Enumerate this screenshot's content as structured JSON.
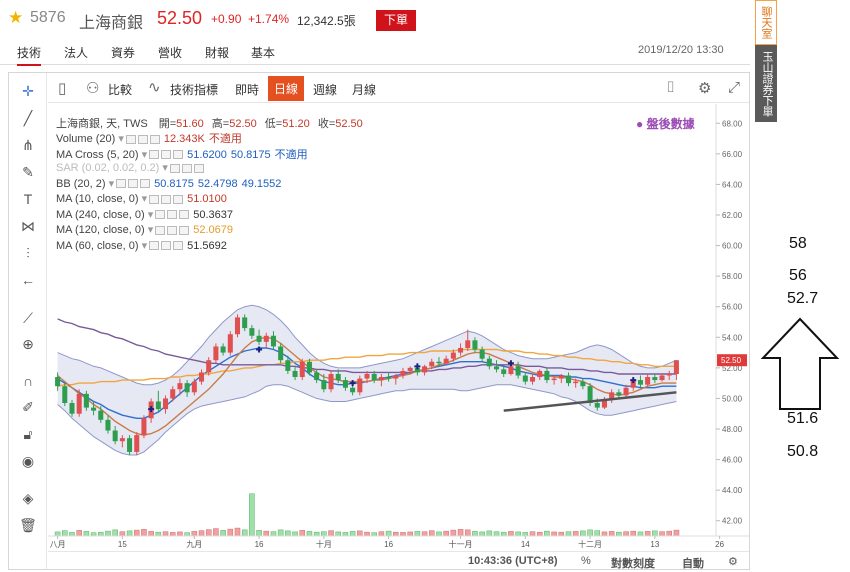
{
  "header": {
    "code": "5876",
    "name": "上海商銀",
    "price": "52.50",
    "change": "+0.90",
    "change_pct": "+1.74%",
    "volume": "12,342.5張",
    "order_button": "下單",
    "star_icon": "star-icon",
    "accent_up": "#e02424",
    "button_color": "#d0121b"
  },
  "tabs": [
    "技術",
    "法人",
    "資券",
    "營收",
    "財報",
    "基本"
  ],
  "datetime": "2019/12/20 13:30",
  "side": {
    "chat": "聊天室",
    "broker": "玉山證券下單"
  },
  "toolbar": {
    "compare": "比較",
    "indicators": "技術指標",
    "intervals": [
      "即時",
      "日線",
      "週線",
      "月線"
    ],
    "active_interval": "日線"
  },
  "legend": {
    "main": {
      "label": "上海商銀, 天, TWS",
      "open_label": "開=",
      "open": "51.60",
      "high_label": "高=",
      "high": "52.50",
      "low_label": "低=",
      "low": "51.20",
      "close_label": "收=",
      "close": "52.50"
    },
    "rows": [
      {
        "label": "Volume (20)",
        "values": [
          "12.343K",
          "不適用"
        ],
        "color": "#c0392b"
      },
      {
        "label": "MA Cross (5, 20)",
        "values": [
          "51.6200",
          "50.8175",
          "不適用"
        ],
        "color": "#1f5fbf"
      },
      {
        "label": "SAR (0.02, 0.02, 0.2)",
        "values": [],
        "color": "#bbbbbb"
      },
      {
        "label": "BB (20, 2)",
        "values": [
          "50.8175",
          "52.4798",
          "49.1552"
        ],
        "color": "#1f5fbf"
      },
      {
        "label": "MA (10, close, 0)",
        "values": [
          "51.0100"
        ],
        "color": "#c0392b"
      },
      {
        "label": "MA (240, close, 0)",
        "values": [
          "50.3637"
        ],
        "color": "#333333"
      },
      {
        "label": "MA (120, close, 0)",
        "values": [
          "52.0679"
        ],
        "color": "#e69b2d"
      },
      {
        "label": "MA (60, close, 0)",
        "values": [
          "51.5692"
        ],
        "color": "#333333"
      }
    ],
    "after_hours": "盤後數據"
  },
  "bottom": {
    "clock": "10:43:36 (UTC+8)",
    "percent": "%",
    "log_scale": "對數刻度",
    "auto": "自動"
  },
  "annotations": {
    "upper": [
      "58",
      "56",
      "52.7"
    ],
    "lower": [
      "51.6",
      "50.8"
    ]
  },
  "chart_data": {
    "type": "candlestick",
    "y_ticks": [
      "68.00",
      "66.00",
      "64.00",
      "62.00",
      "60.00",
      "58.00",
      "56.00",
      "54.00",
      "52.00",
      "50.00",
      "48.00",
      "46.00",
      "44.00",
      "42.00"
    ],
    "ylim": [
      41,
      69
    ],
    "x_ticks": [
      "八月",
      "15",
      "九月",
      "16",
      "十月",
      "16",
      "十一月",
      "14",
      "十二月",
      "13",
      "26"
    ],
    "x_tick_index": [
      0,
      9,
      19,
      28,
      37,
      46,
      56,
      65,
      74,
      83,
      92
    ],
    "last_price": "52.50",
    "colors": {
      "up": "#e05050",
      "down": "#2e9e4e",
      "band": "#dde2f0",
      "band_line": "#8f97c8"
    },
    "ohlc": [
      [
        51.4,
        51.7,
        50.5,
        50.8
      ],
      [
        50.8,
        51.0,
        49.5,
        49.7
      ],
      [
        49.7,
        49.9,
        48.8,
        49.0
      ],
      [
        49.0,
        50.6,
        48.8,
        50.3
      ],
      [
        50.3,
        50.5,
        49.2,
        49.4
      ],
      [
        49.4,
        49.8,
        48.9,
        49.2
      ],
      [
        49.2,
        49.5,
        48.4,
        48.6
      ],
      [
        48.6,
        48.9,
        47.7,
        47.9
      ],
      [
        47.9,
        48.2,
        47.0,
        47.2
      ],
      [
        47.2,
        47.6,
        46.8,
        47.4
      ],
      [
        47.4,
        47.6,
        46.3,
        46.5
      ],
      [
        46.5,
        47.8,
        46.3,
        47.6
      ],
      [
        47.6,
        48.9,
        47.4,
        48.7
      ],
      [
        48.7,
        50.0,
        48.4,
        49.8
      ],
      [
        49.8,
        50.5,
        49.1,
        49.3
      ],
      [
        49.3,
        50.2,
        49.0,
        50.0
      ],
      [
        50.0,
        50.8,
        49.8,
        50.6
      ],
      [
        50.6,
        51.3,
        50.2,
        51.0
      ],
      [
        51.0,
        51.2,
        50.1,
        50.4
      ],
      [
        50.4,
        51.3,
        50.2,
        51.1
      ],
      [
        51.1,
        51.9,
        50.9,
        51.7
      ],
      [
        51.7,
        52.7,
        51.5,
        52.5
      ],
      [
        52.5,
        53.6,
        52.3,
        53.4
      ],
      [
        53.4,
        53.6,
        52.8,
        53.0
      ],
      [
        53.0,
        54.4,
        52.8,
        54.2
      ],
      [
        54.2,
        55.5,
        54.0,
        55.3
      ],
      [
        55.3,
        55.5,
        54.4,
        54.6
      ],
      [
        54.6,
        54.8,
        53.9,
        54.1
      ],
      [
        54.1,
        54.5,
        53.5,
        53.7
      ],
      [
        53.7,
        54.3,
        53.3,
        54.1
      ],
      [
        54.1,
        54.4,
        53.2,
        53.4
      ],
      [
        53.4,
        53.6,
        52.3,
        52.5
      ],
      [
        52.5,
        52.8,
        51.6,
        51.8
      ],
      [
        51.8,
        52.1,
        51.2,
        51.4
      ],
      [
        51.4,
        52.6,
        51.2,
        52.4
      ],
      [
        52.4,
        52.6,
        51.5,
        51.7
      ],
      [
        51.7,
        51.9,
        51.0,
        51.2
      ],
      [
        51.2,
        51.6,
        50.4,
        50.6
      ],
      [
        50.6,
        51.8,
        50.4,
        51.6
      ],
      [
        51.6,
        51.9,
        51.0,
        51.2
      ],
      [
        51.2,
        51.4,
        50.5,
        50.7
      ],
      [
        50.7,
        51.2,
        50.2,
        50.4
      ],
      [
        50.4,
        51.5,
        50.2,
        51.3
      ],
      [
        51.3,
        51.8,
        51.0,
        51.6
      ],
      [
        51.6,
        51.8,
        51.0,
        51.2
      ],
      [
        51.2,
        51.6,
        50.8,
        51.4
      ],
      [
        51.4,
        51.7,
        51.1,
        51.3
      ],
      [
        51.3,
        51.6,
        50.9,
        51.5
      ],
      [
        51.5,
        52.0,
        51.3,
        51.8
      ],
      [
        51.8,
        52.1,
        51.6,
        52.0
      ],
      [
        52.0,
        52.3,
        51.5,
        51.7
      ],
      [
        51.7,
        52.2,
        51.5,
        52.1
      ],
      [
        52.1,
        52.6,
        51.9,
        52.4
      ],
      [
        52.4,
        52.7,
        52.1,
        52.3
      ],
      [
        52.3,
        52.8,
        52.2,
        52.6
      ],
      [
        52.6,
        53.2,
        52.4,
        53.0
      ],
      [
        53.0,
        53.6,
        52.8,
        53.3
      ],
      [
        53.3,
        54.5,
        53.1,
        53.8
      ],
      [
        53.8,
        54.0,
        53.0,
        53.2
      ],
      [
        53.2,
        53.4,
        52.4,
        52.6
      ],
      [
        52.6,
        52.8,
        51.9,
        52.1
      ],
      [
        52.1,
        52.5,
        51.7,
        51.9
      ],
      [
        51.9,
        52.1,
        51.4,
        51.6
      ],
      [
        51.6,
        52.3,
        51.5,
        52.1
      ],
      [
        52.1,
        52.4,
        51.3,
        51.5
      ],
      [
        51.5,
        51.7,
        50.9,
        51.1
      ],
      [
        51.1,
        51.6,
        50.9,
        51.4
      ],
      [
        51.4,
        51.9,
        51.2,
        51.8
      ],
      [
        51.8,
        52.0,
        51.0,
        51.2
      ],
      [
        51.2,
        51.5,
        50.9,
        51.3
      ],
      [
        51.3,
        51.6,
        51.0,
        51.5
      ],
      [
        51.5,
        51.7,
        50.8,
        51.0
      ],
      [
        51.0,
        51.3,
        50.7,
        51.1
      ],
      [
        51.1,
        51.3,
        50.6,
        50.8
      ],
      [
        50.8,
        51.0,
        49.5,
        49.7
      ],
      [
        49.7,
        50.0,
        49.2,
        49.4
      ],
      [
        49.4,
        50.1,
        49.3,
        49.9
      ],
      [
        49.9,
        50.6,
        49.7,
        50.4
      ],
      [
        50.4,
        50.6,
        50.0,
        50.2
      ],
      [
        50.2,
        50.9,
        50.0,
        50.7
      ],
      [
        50.7,
        51.4,
        50.5,
        51.2
      ],
      [
        51.2,
        51.5,
        50.7,
        50.9
      ],
      [
        50.9,
        51.6,
        50.8,
        51.4
      ],
      [
        51.4,
        51.6,
        51.0,
        51.2
      ],
      [
        51.2,
        51.6,
        51.1,
        51.5
      ],
      [
        51.5,
        51.8,
        51.2,
        51.6
      ],
      [
        51.6,
        52.5,
        51.2,
        52.5
      ]
    ],
    "volume_max": 20000,
    "volume": [
      1600,
      2100,
      1400,
      2200,
      1800,
      1300,
      1500,
      1900,
      2400,
      1700,
      2000,
      2300,
      2600,
      1800,
      1500,
      1700,
      1400,
      1600,
      1300,
      1800,
      2100,
      2500,
      2900,
      2200,
      2700,
      3100,
      2400,
      16500,
      2200,
      1900,
      1700,
      2400,
      2000,
      1600,
      2200,
      1800,
      1500,
      1700,
      2100,
      1600,
      1400,
      1800,
      2000,
      1500,
      1300,
      1700,
      1900,
      1500,
      1400,
      1600,
      1800,
      1700,
      2100,
      1600,
      1900,
      2300,
      2600,
      2400,
      1800,
      1600,
      2000,
      1700,
      1500,
      1800,
      1600,
      1400,
      1700,
      1500,
      1900,
      1600,
      1500,
      1700,
      1800,
      2000,
      2400,
      2100,
      1600,
      1800,
      1500,
      1700,
      1900,
      1600,
      1800,
      2000,
      1700,
      1900,
      2300
    ],
    "lines": [
      {
        "name": "BB upper",
        "color": "#8f97c8",
        "values": [
          53.0,
          52.8,
          52.6,
          52.5,
          52.3,
          52.1,
          52.0,
          51.8,
          51.6,
          51.4,
          51.2,
          51.0,
          50.9,
          50.9,
          51.0,
          51.2,
          51.5,
          51.9,
          52.4,
          52.9,
          53.4,
          54.0,
          54.5,
          55.0,
          55.4,
          55.8,
          56.0,
          56.1,
          56.0,
          55.8,
          55.5,
          55.1,
          54.6,
          54.0,
          53.5,
          53.0,
          52.6,
          52.3,
          52.1,
          52.0,
          52.0,
          52.0,
          52.0,
          52.1,
          52.2,
          52.3,
          52.4,
          52.5,
          52.6,
          52.8,
          53.0,
          53.2,
          53.4,
          53.6,
          53.8,
          54.0,
          54.2,
          54.4,
          54.3,
          54.1,
          53.8,
          53.5,
          53.2,
          53.0,
          52.8,
          52.7,
          52.6,
          52.6,
          52.6,
          52.7,
          52.8,
          52.9,
          53.0,
          53.2,
          53.4,
          53.5,
          53.4,
          53.2,
          52.9,
          52.6,
          52.3,
          52.1,
          52.0,
          52.0,
          52.1,
          52.3,
          52.5
        ]
      },
      {
        "name": "BB lower",
        "color": "#8f97c8",
        "values": [
          49.6,
          49.2,
          48.7,
          48.3,
          47.9,
          47.5,
          47.2,
          46.9,
          46.6,
          46.4,
          46.3,
          46.3,
          46.5,
          46.9,
          47.3,
          47.8,
          48.2,
          48.6,
          49.0,
          49.3,
          49.5,
          49.6,
          49.7,
          49.8,
          49.9,
          50.0,
          50.1,
          50.3,
          50.5,
          50.8,
          50.9,
          50.9,
          50.8,
          50.6,
          50.4,
          50.2,
          50.0,
          49.9,
          49.8,
          49.8,
          49.8,
          49.9,
          50.0,
          50.1,
          50.2,
          50.3,
          50.4,
          50.5,
          50.5,
          50.6,
          50.6,
          50.6,
          50.6,
          50.6,
          50.6,
          50.6,
          50.5,
          50.5,
          50.6,
          50.7,
          50.8,
          50.9,
          50.9,
          50.9,
          50.8,
          50.7,
          50.6,
          50.5,
          50.4,
          50.3,
          50.1,
          50.0,
          49.8,
          49.5,
          49.2,
          49.0,
          48.9,
          48.9,
          49.0,
          49.1,
          49.2,
          49.3,
          49.4,
          49.5,
          49.6,
          49.7,
          49.8
        ]
      },
      {
        "name": "BB mid",
        "color": "#2f6fcf",
        "values": [
          51.3,
          51.0,
          50.7,
          50.4,
          50.1,
          49.8,
          49.6,
          49.3,
          49.1,
          48.9,
          48.8,
          48.7,
          48.7,
          48.9,
          49.1,
          49.5,
          49.9,
          50.3,
          50.7,
          51.1,
          51.5,
          51.8,
          52.1,
          52.4,
          52.7,
          52.9,
          53.1,
          53.2,
          53.3,
          53.3,
          53.2,
          53.0,
          52.7,
          52.3,
          52.0,
          51.6,
          51.3,
          51.1,
          51.0,
          50.9,
          50.9,
          51.0,
          51.0,
          51.1,
          51.2,
          51.3,
          51.4,
          51.5,
          51.6,
          51.7,
          51.8,
          51.9,
          52.0,
          52.1,
          52.2,
          52.3,
          52.4,
          52.4,
          52.4,
          52.4,
          52.3,
          52.2,
          52.1,
          52.0,
          51.8,
          51.7,
          51.6,
          51.5,
          51.5,
          51.5,
          51.5,
          51.4,
          51.4,
          51.3,
          51.3,
          51.2,
          51.1,
          51.0,
          50.9,
          50.8,
          50.8,
          50.7,
          50.7,
          50.7,
          50.8,
          50.8,
          50.8
        ]
      },
      {
        "name": "MA 120",
        "color": "#f0a640",
        "values": [
          50.8,
          50.9,
          50.9,
          51.0,
          51.0,
          51.0,
          51.1,
          51.1,
          51.1,
          51.2,
          51.2,
          51.2,
          51.2,
          51.3,
          51.3,
          51.3,
          51.4,
          51.4,
          51.5,
          51.5,
          51.6,
          51.6,
          51.7,
          51.8,
          51.8,
          51.9,
          52.0,
          52.0,
          52.1,
          52.2,
          52.2,
          52.3,
          52.3,
          52.4,
          52.4,
          52.5,
          52.5,
          52.5,
          52.6,
          52.6,
          52.7,
          52.7,
          52.7,
          52.8,
          52.8,
          52.8,
          52.9,
          52.9,
          52.9,
          53.0,
          53.0,
          53.0,
          53.1,
          53.1,
          53.1,
          53.1,
          53.2,
          53.2,
          53.2,
          53.2,
          53.2,
          53.2,
          53.1,
          53.1,
          53.1,
          53.0,
          53.0,
          52.9,
          52.9,
          52.8,
          52.8,
          52.7,
          52.7,
          52.6,
          52.6,
          52.5,
          52.5,
          52.4,
          52.4,
          52.3,
          52.3,
          52.2,
          52.2,
          52.1,
          52.1,
          52.1,
          52.1
        ]
      },
      {
        "name": "MA 60",
        "color": "#7a5a9a",
        "values": [
          55.2,
          55.0,
          54.9,
          54.7,
          54.6,
          54.5,
          54.3,
          54.2,
          54.0,
          53.9,
          53.7,
          53.5,
          53.4,
          53.2,
          53.1,
          52.9,
          52.8,
          52.7,
          52.6,
          52.5,
          52.4,
          52.3,
          52.3,
          52.2,
          52.2,
          52.2,
          52.2,
          52.2,
          52.2,
          52.2,
          52.2,
          52.2,
          52.1,
          52.1,
          52.0,
          52.0,
          51.9,
          51.9,
          51.8,
          51.8,
          51.8,
          51.7,
          51.7,
          51.7,
          51.7,
          51.7,
          51.7,
          51.7,
          51.7,
          51.7,
          51.8,
          51.8,
          51.8,
          51.9,
          51.9,
          52.0,
          52.0,
          52.1,
          52.1,
          52.2,
          52.2,
          52.2,
          52.2,
          52.2,
          52.2,
          52.1,
          52.1,
          52.1,
          52.0,
          52.0,
          52.0,
          51.9,
          51.9,
          51.9,
          51.8,
          51.8,
          51.7,
          51.7,
          51.6,
          51.6,
          51.6,
          51.6,
          51.6,
          51.6,
          51.6,
          51.6,
          51.6
        ]
      },
      {
        "name": "MA 10",
        "color": "#c77d4a",
        "values": [
          51.5,
          51.1,
          50.7,
          50.3,
          50.0,
          49.6,
          49.3,
          48.9,
          48.5,
          48.2,
          47.9,
          47.7,
          47.6,
          47.7,
          47.9,
          48.2,
          48.6,
          49.0,
          49.4,
          49.8,
          50.2,
          50.6,
          51.1,
          51.6,
          52.2,
          52.8,
          53.3,
          53.7,
          53.9,
          54.0,
          53.9,
          53.6,
          53.2,
          52.8,
          52.4,
          52.0,
          51.7,
          51.4,
          51.3,
          51.2,
          51.1,
          51.1,
          51.1,
          51.1,
          51.2,
          51.2,
          51.3,
          51.4,
          51.5,
          51.6,
          51.8,
          51.9,
          52.0,
          52.2,
          52.3,
          52.5,
          52.7,
          52.9,
          53.0,
          53.0,
          52.9,
          52.7,
          52.5,
          52.3,
          52.1,
          51.9,
          51.7,
          51.6,
          51.5,
          51.4,
          51.4,
          51.3,
          51.2,
          51.1,
          50.9,
          50.6,
          50.4,
          50.3,
          50.2,
          50.3,
          50.4,
          50.6,
          50.8,
          50.9,
          51.0,
          51.0,
          51.0
        ]
      }
    ],
    "markers": [
      {
        "index": 13,
        "value": 49.3
      },
      {
        "index": 28,
        "value": 53.2
      },
      {
        "index": 41,
        "value": 51.0
      },
      {
        "index": 50,
        "value": 52.1
      },
      {
        "index": 63,
        "value": 52.3
      },
      {
        "index": 80,
        "value": 51.2
      }
    ],
    "trendline": {
      "from": [
        62,
        49.2
      ],
      "to": [
        86,
        50.4
      ],
      "color": "#555555"
    }
  }
}
